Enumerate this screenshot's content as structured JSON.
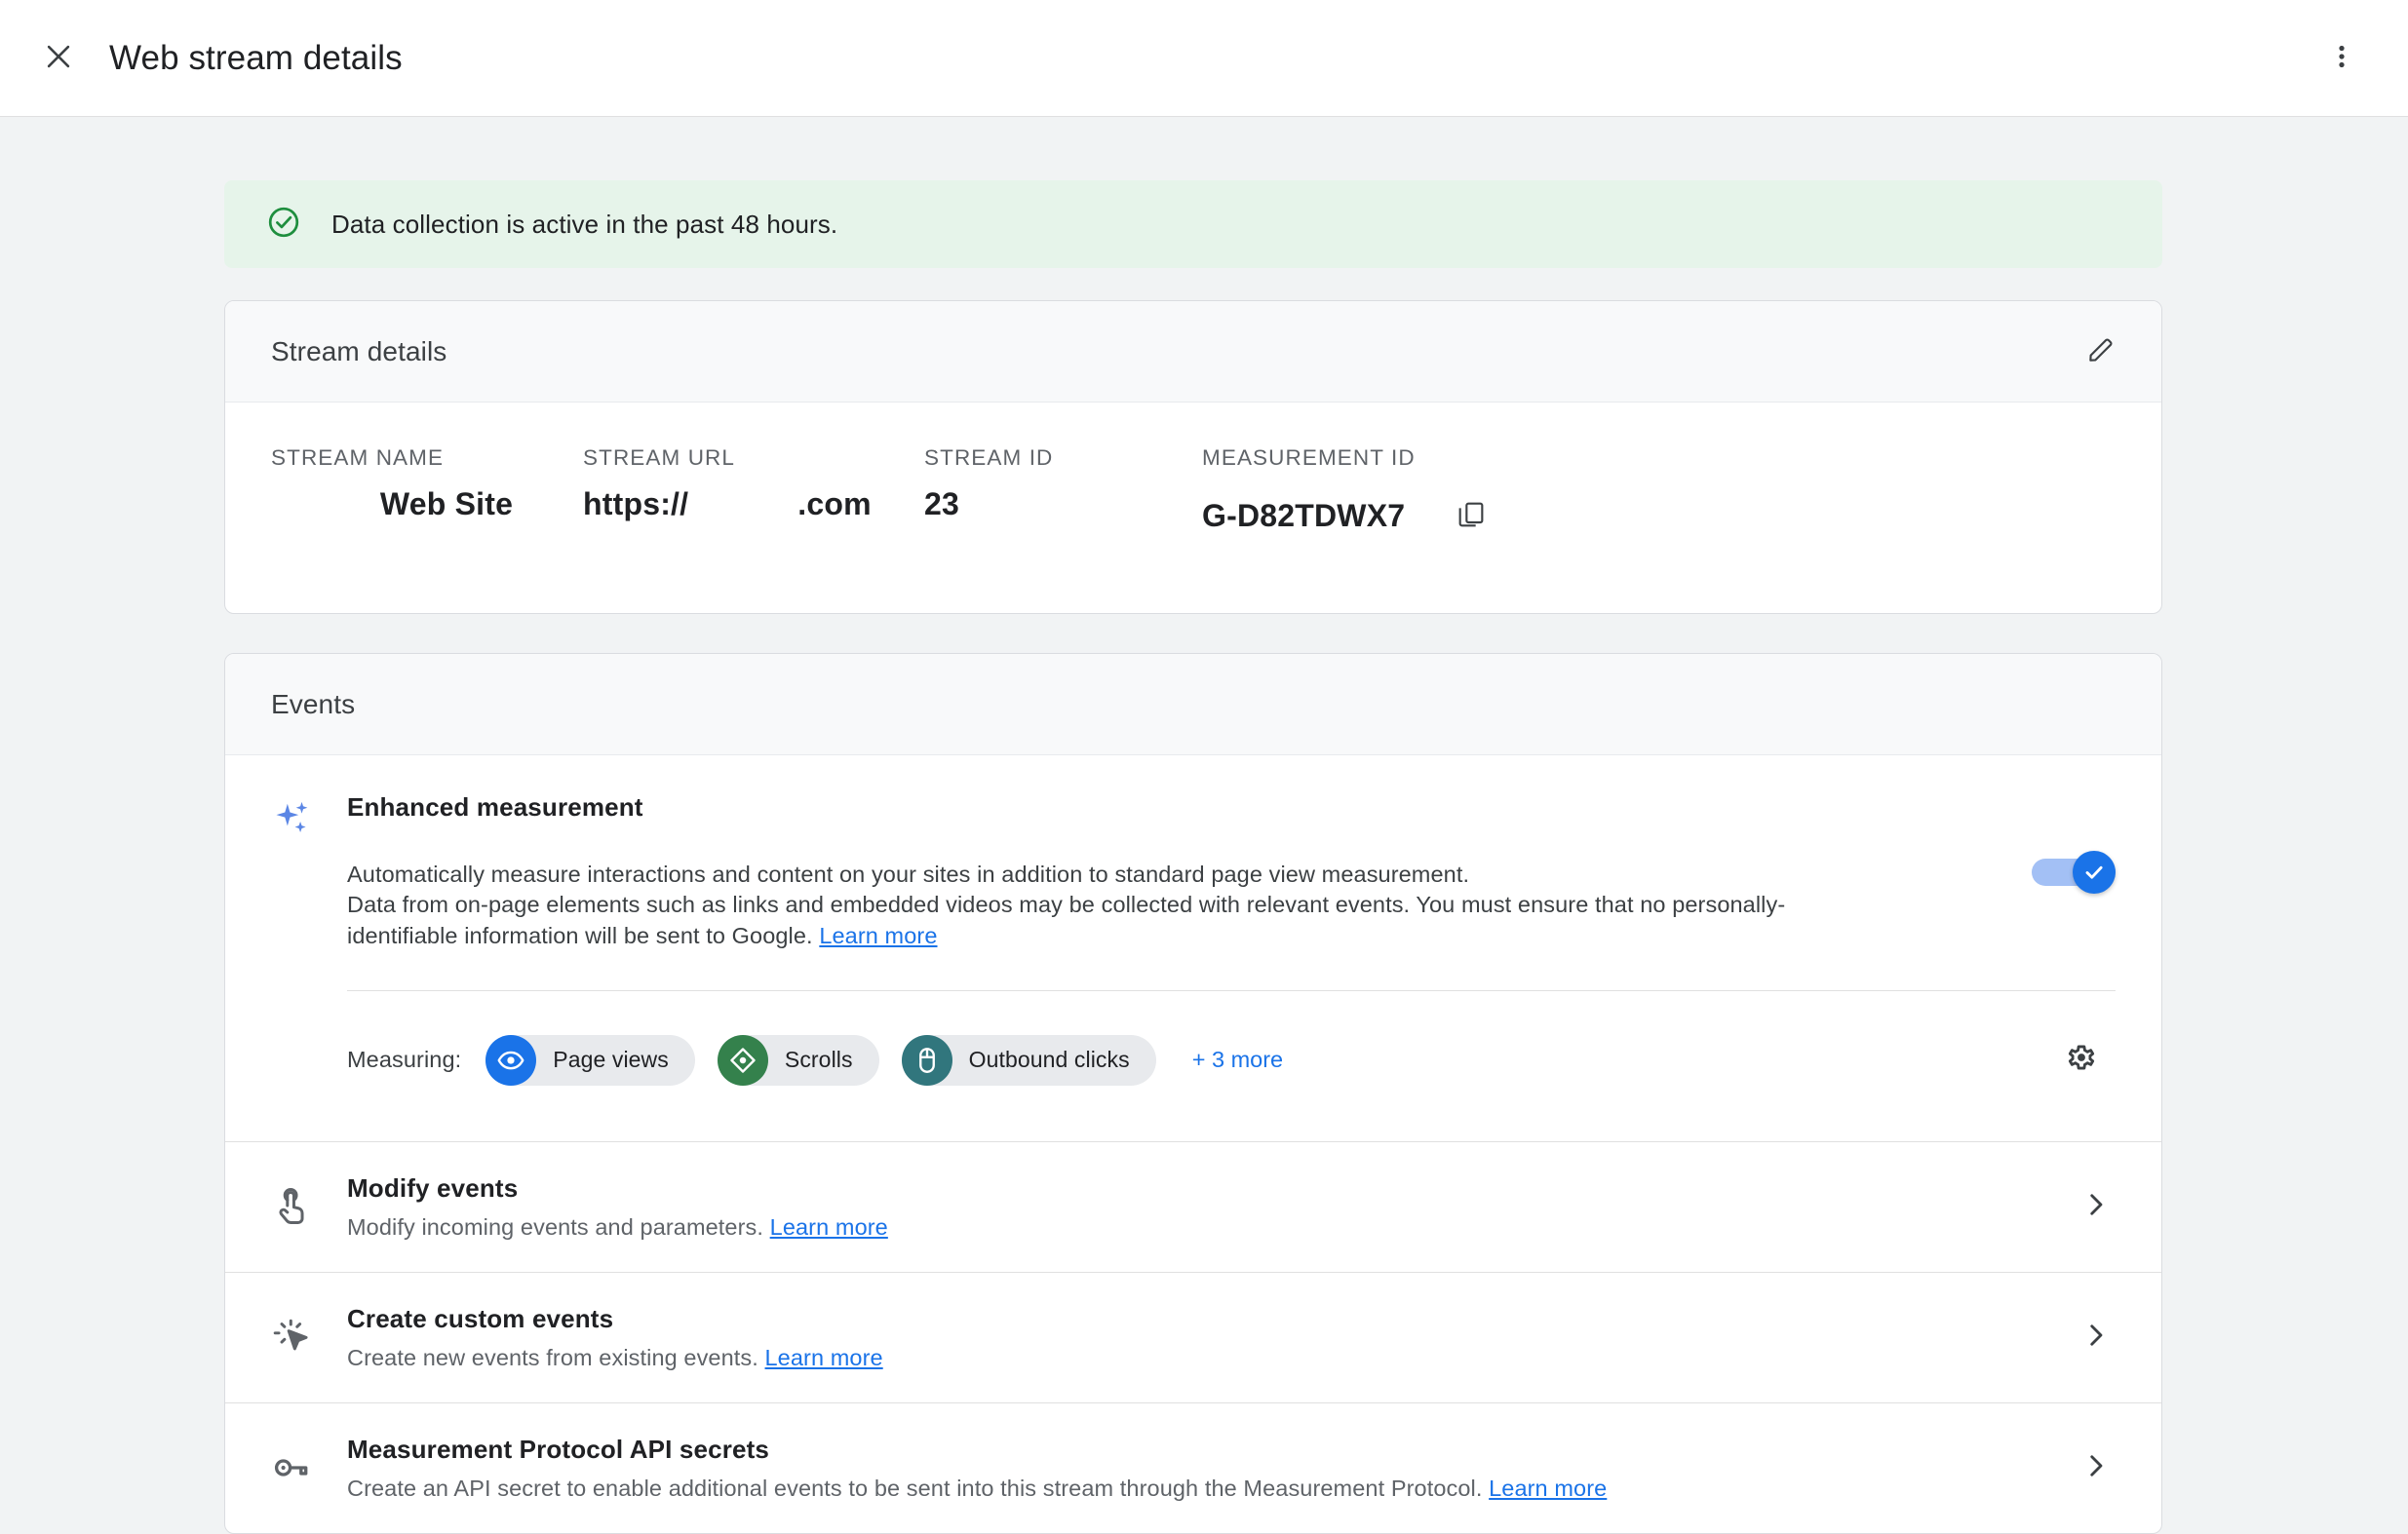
{
  "appbar": {
    "close_icon": "close-icon",
    "title": "Web stream details",
    "overflow_icon": "more-vert-icon"
  },
  "banner": {
    "icon": "check-circle-icon",
    "text": "Data collection is active in the past 48 hours.",
    "bg_color": "#e6f4ea",
    "icon_color": "#1e8e3e"
  },
  "stream_details": {
    "header": "Stream details",
    "edit_icon": "edit-pencil-icon",
    "fields": [
      {
        "label": "STREAM NAME",
        "value": "Web Site"
      },
      {
        "label": "STREAM URL",
        "value_prefix": "https://",
        "value_suffix": ".com"
      },
      {
        "label": "STREAM ID",
        "value": "23"
      },
      {
        "label": "MEASUREMENT ID",
        "value": "G-D82TDWX7",
        "copy_icon": "copy-icon"
      }
    ]
  },
  "events": {
    "header": "Events",
    "enhanced_measurement": {
      "icon": "sparkles-icon",
      "title": "Enhanced measurement",
      "description_line1": "Automatically measure interactions and content on your sites in addition to standard page view measurement.",
      "description_line2": "Data from on-page elements such as links and embedded videos may be collected with relevant events. You must ensure that no personally-identifiable information will be sent to Google.",
      "learn_more": "Learn more",
      "toggle_on": true,
      "measuring_label": "Measuring:",
      "chips": [
        {
          "label": "Page views",
          "icon": "eye-icon",
          "color": "#1a73e8"
        },
        {
          "label": "Scrolls",
          "icon": "scroll-diamond-icon",
          "color": "#34814c"
        },
        {
          "label": "Outbound clicks",
          "icon": "mouse-icon",
          "color": "#31767d"
        }
      ],
      "more_label": "+ 3 more",
      "settings_icon": "gear-icon"
    },
    "rows": [
      {
        "icon": "touch-app-icon",
        "title": "Modify events",
        "description": "Modify incoming events and parameters.",
        "learn_more": "Learn more",
        "chevron": "chevron-right-icon"
      },
      {
        "icon": "ads-click-icon",
        "title": "Create custom events",
        "description": "Create new events from existing events.",
        "learn_more": "Learn more",
        "chevron": "chevron-right-icon"
      },
      {
        "icon": "key-icon",
        "title": "Measurement Protocol API secrets",
        "description": "Create an API secret to enable additional events to be sent into this stream through the Measurement Protocol.",
        "learn_more": "Learn more",
        "chevron": "chevron-right-icon"
      }
    ]
  }
}
